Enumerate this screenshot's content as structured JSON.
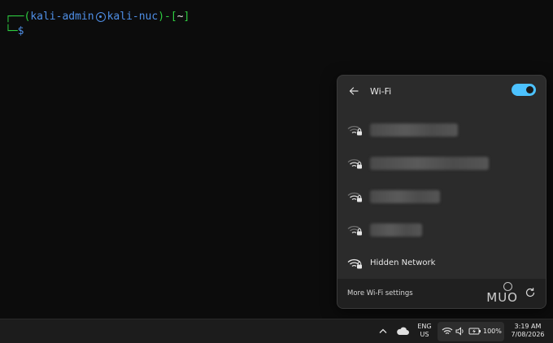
{
  "terminal": {
    "user": "kali-admin",
    "host": "kali-nuc",
    "cwd": "~",
    "prompt_symbol": "$"
  },
  "wifi_panel": {
    "title": "Wi-Fi",
    "toggle_on": true,
    "networks": [
      {
        "name": "",
        "blurred": true,
        "secured": true
      },
      {
        "name": "",
        "blurred": true,
        "secured": true
      },
      {
        "name": "",
        "blurred": true,
        "secured": true
      },
      {
        "name": "",
        "blurred": true,
        "secured": true
      },
      {
        "name": "Hidden Network",
        "blurred": false,
        "secured": true
      }
    ],
    "more_settings_label": "More Wi-Fi settings",
    "watermark": "MUO"
  },
  "taskbar": {
    "language_line1": "ENG",
    "language_line2": "US",
    "battery_percent": "100%",
    "time": "3:19 AM",
    "date": "7/08/2026"
  },
  "colors": {
    "accent": "#4cc2ff",
    "terminal_green": "#2ecc40",
    "terminal_blue": "#4f8fe6"
  }
}
